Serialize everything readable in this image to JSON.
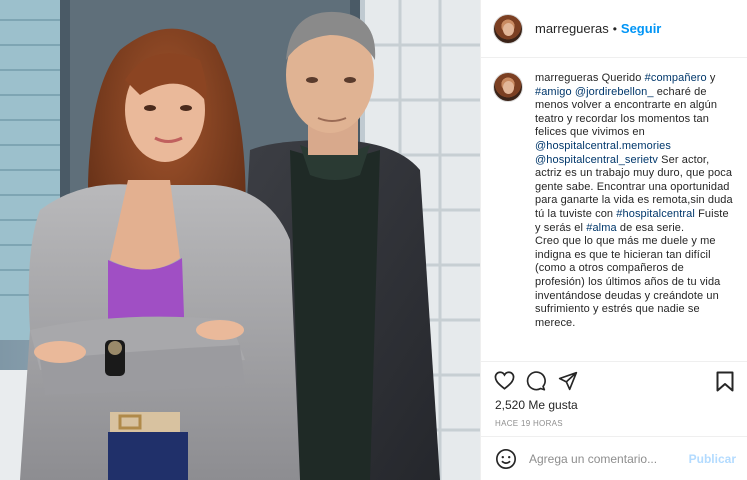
{
  "post": {
    "username": "marregueras",
    "separator": "•",
    "follow_label": "Seguir"
  },
  "caption": {
    "username": "marregueras",
    "segments": [
      {
        "type": "text",
        "value": " Querido "
      },
      {
        "type": "link",
        "value": "#compañero"
      },
      {
        "type": "text",
        "value": " y "
      },
      {
        "type": "link",
        "value": "#amigo"
      },
      {
        "type": "text",
        "value": " "
      },
      {
        "type": "link",
        "value": "@jordirebellon_"
      },
      {
        "type": "text",
        "value": " echaré de menos volver a encontrarte en algún teatro y recordar los momentos tan felices que vivimos en "
      },
      {
        "type": "link",
        "value": "@hospitalcentral.memories"
      },
      {
        "type": "text",
        "value": " "
      },
      {
        "type": "link",
        "value": "@hospitalcentral_serietv"
      },
      {
        "type": "text",
        "value": " Ser actor, actriz es un trabajo muy duro, que poca gente sabe. Encontrar una oportunidad para ganarte la vida es remota,sin duda tú la tuviste con "
      },
      {
        "type": "link",
        "value": "#hospitalcentral"
      },
      {
        "type": "text",
        "value": " Fuiste y serás el "
      },
      {
        "type": "link",
        "value": "#alma"
      },
      {
        "type": "text",
        "value": " de esa serie."
      },
      {
        "type": "break",
        "value": ""
      },
      {
        "type": "text",
        "value": "Creo que lo que más me duele y me indigna es que te hicieran tan difícil (como a otros compañeros de profesión) los últimos años de tu vida inventándose deudas y creándote un sufrimiento y estrés que nadie se merece."
      }
    ]
  },
  "actions": {
    "like_icon": "heart-icon",
    "comment_icon": "comment-icon",
    "share_icon": "paper-plane-icon",
    "save_icon": "bookmark-icon"
  },
  "likes": "2,520 Me gusta",
  "time_ago": "HACE 19 HORAS",
  "comment": {
    "emoji_icon": "smiley-icon",
    "placeholder": "Agrega un comentario...",
    "value": "",
    "publish_label": "Publicar"
  },
  "colors": {
    "link": "#00376b",
    "follow": "#0095f6",
    "publish_disabled": "#b3dbff",
    "muted": "#8e8e8e",
    "border": "#efefef"
  }
}
